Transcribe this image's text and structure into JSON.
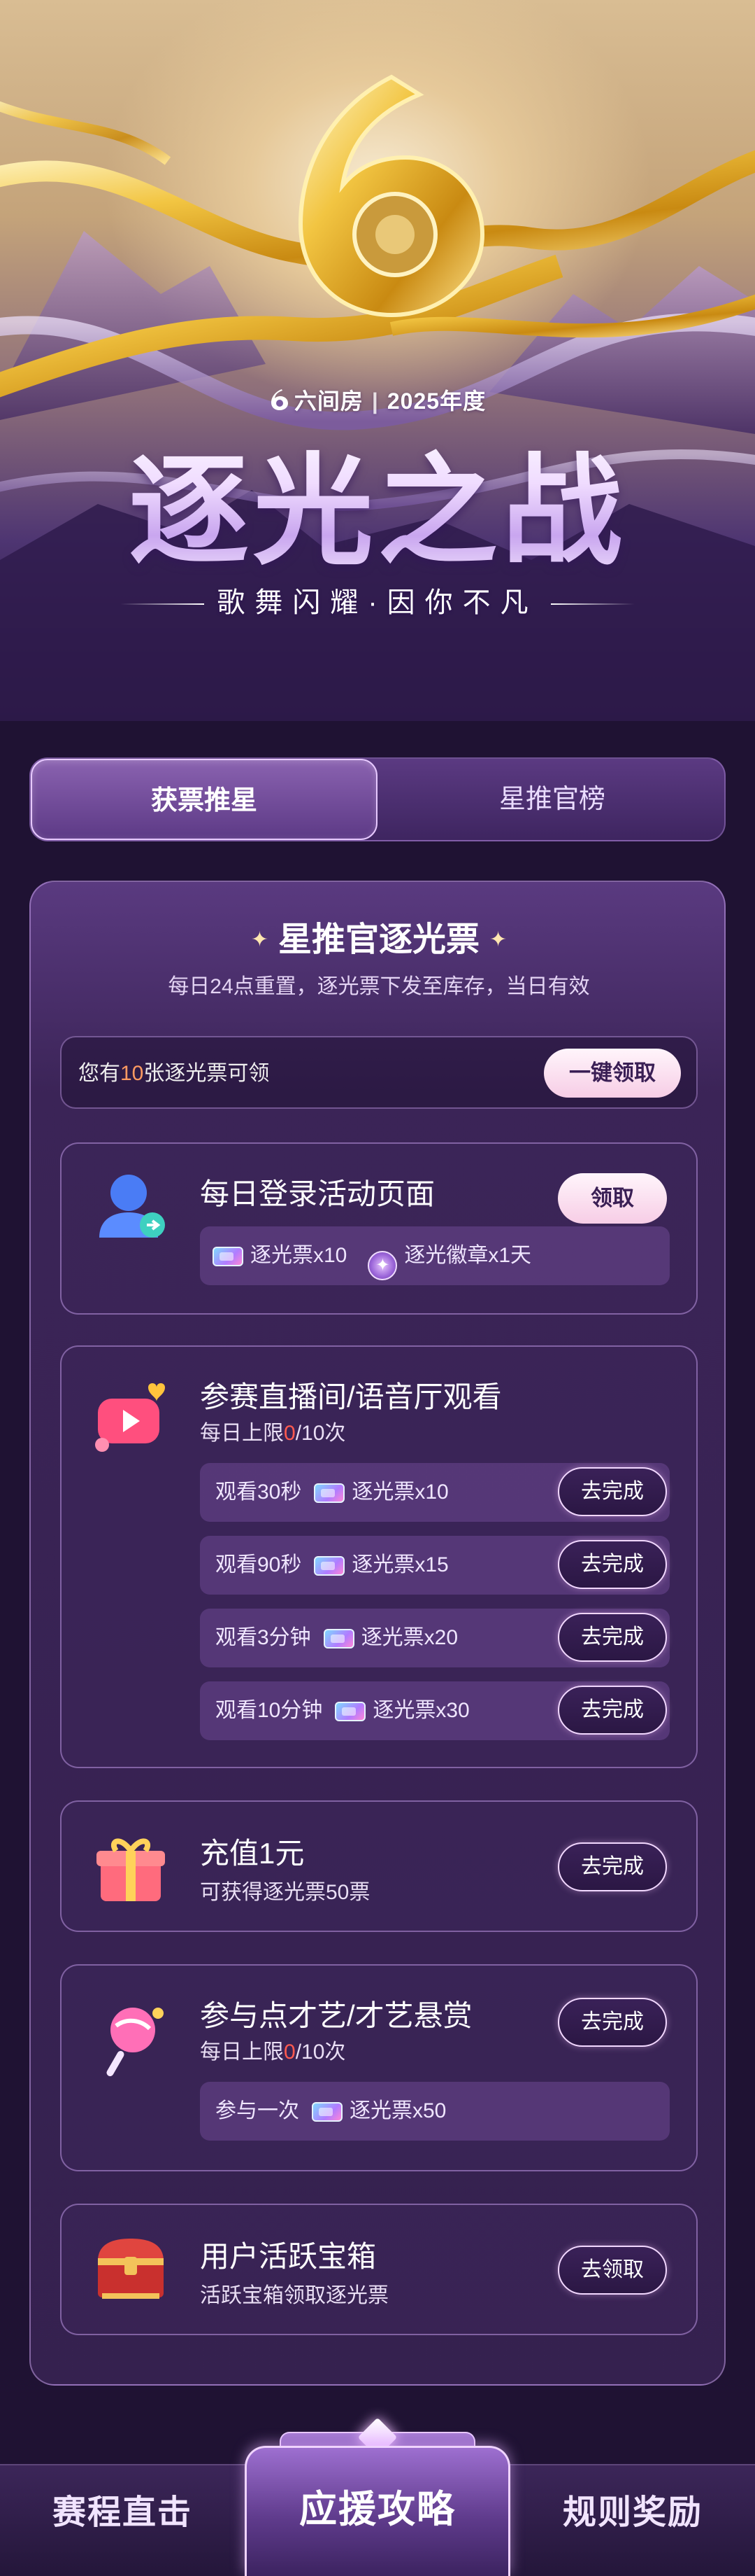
{
  "hero": {
    "brand": "六间房",
    "year": "2025年度",
    "title": "逐光之战",
    "subtitle": "歌舞闪耀·因你不凡"
  },
  "tabs": [
    {
      "label": "获票推星",
      "active": true
    },
    {
      "label": "星推官榜",
      "active": false
    }
  ],
  "panel": {
    "title": "星推官逐光票",
    "desc": "每日24点重置，逐光票下发至库存，当日有效",
    "vote_prefix": "您有",
    "vote_count": "10",
    "vote_suffix": "张逐光票可领",
    "claim_all": "一键领取"
  },
  "tasks": {
    "login": {
      "title": "每日登录活动页面",
      "button": "领取",
      "reward1": "逐光票x10",
      "reward2": "逐光徽章x1天"
    },
    "watch": {
      "title": "参赛直播间/语音厅观看",
      "limit_prefix": "每日上限",
      "limit_done": "0",
      "limit_suffix": "/10次",
      "rows": [
        {
          "label": "观看30秒",
          "reward": "逐光票x10",
          "button": "去完成"
        },
        {
          "label": "观看90秒",
          "reward": "逐光票x15",
          "button": "去完成"
        },
        {
          "label": "观看3分钟",
          "reward": "逐光票x20",
          "button": "去完成"
        },
        {
          "label": "观看10分钟",
          "reward": "逐光票x30",
          "button": "去完成"
        }
      ]
    },
    "recharge": {
      "title": "充值1元",
      "sub": "可获得逐光票50票",
      "button": "去完成"
    },
    "talent": {
      "title": "参与点才艺/才艺悬赏",
      "limit_prefix": "每日上限",
      "limit_done": "0",
      "limit_suffix": "/10次",
      "row_label": "参与一次",
      "row_reward": "逐光票x50",
      "button": "去完成"
    },
    "chest": {
      "title": "用户活跃宝箱",
      "sub": "活跃宝箱领取逐光票",
      "button": "去领取"
    }
  },
  "bottom_nav": [
    {
      "label": "赛程直击"
    },
    {
      "label": "应援攻略",
      "active": true
    },
    {
      "label": "规则奖励"
    }
  ],
  "colors": {
    "background": "#1f1233",
    "highlight_orange": "#ff9a62",
    "highlight_red": "#ff5a4f",
    "button_pink": "#f7cde6"
  },
  "icons": [
    "logo-6-icon",
    "sparkle-icon",
    "user-icon",
    "video-play-icon",
    "gift-box-icon",
    "lollipop-icon",
    "treasure-chest-icon",
    "ticket-icon",
    "badge-icon",
    "diamond-icon"
  ]
}
